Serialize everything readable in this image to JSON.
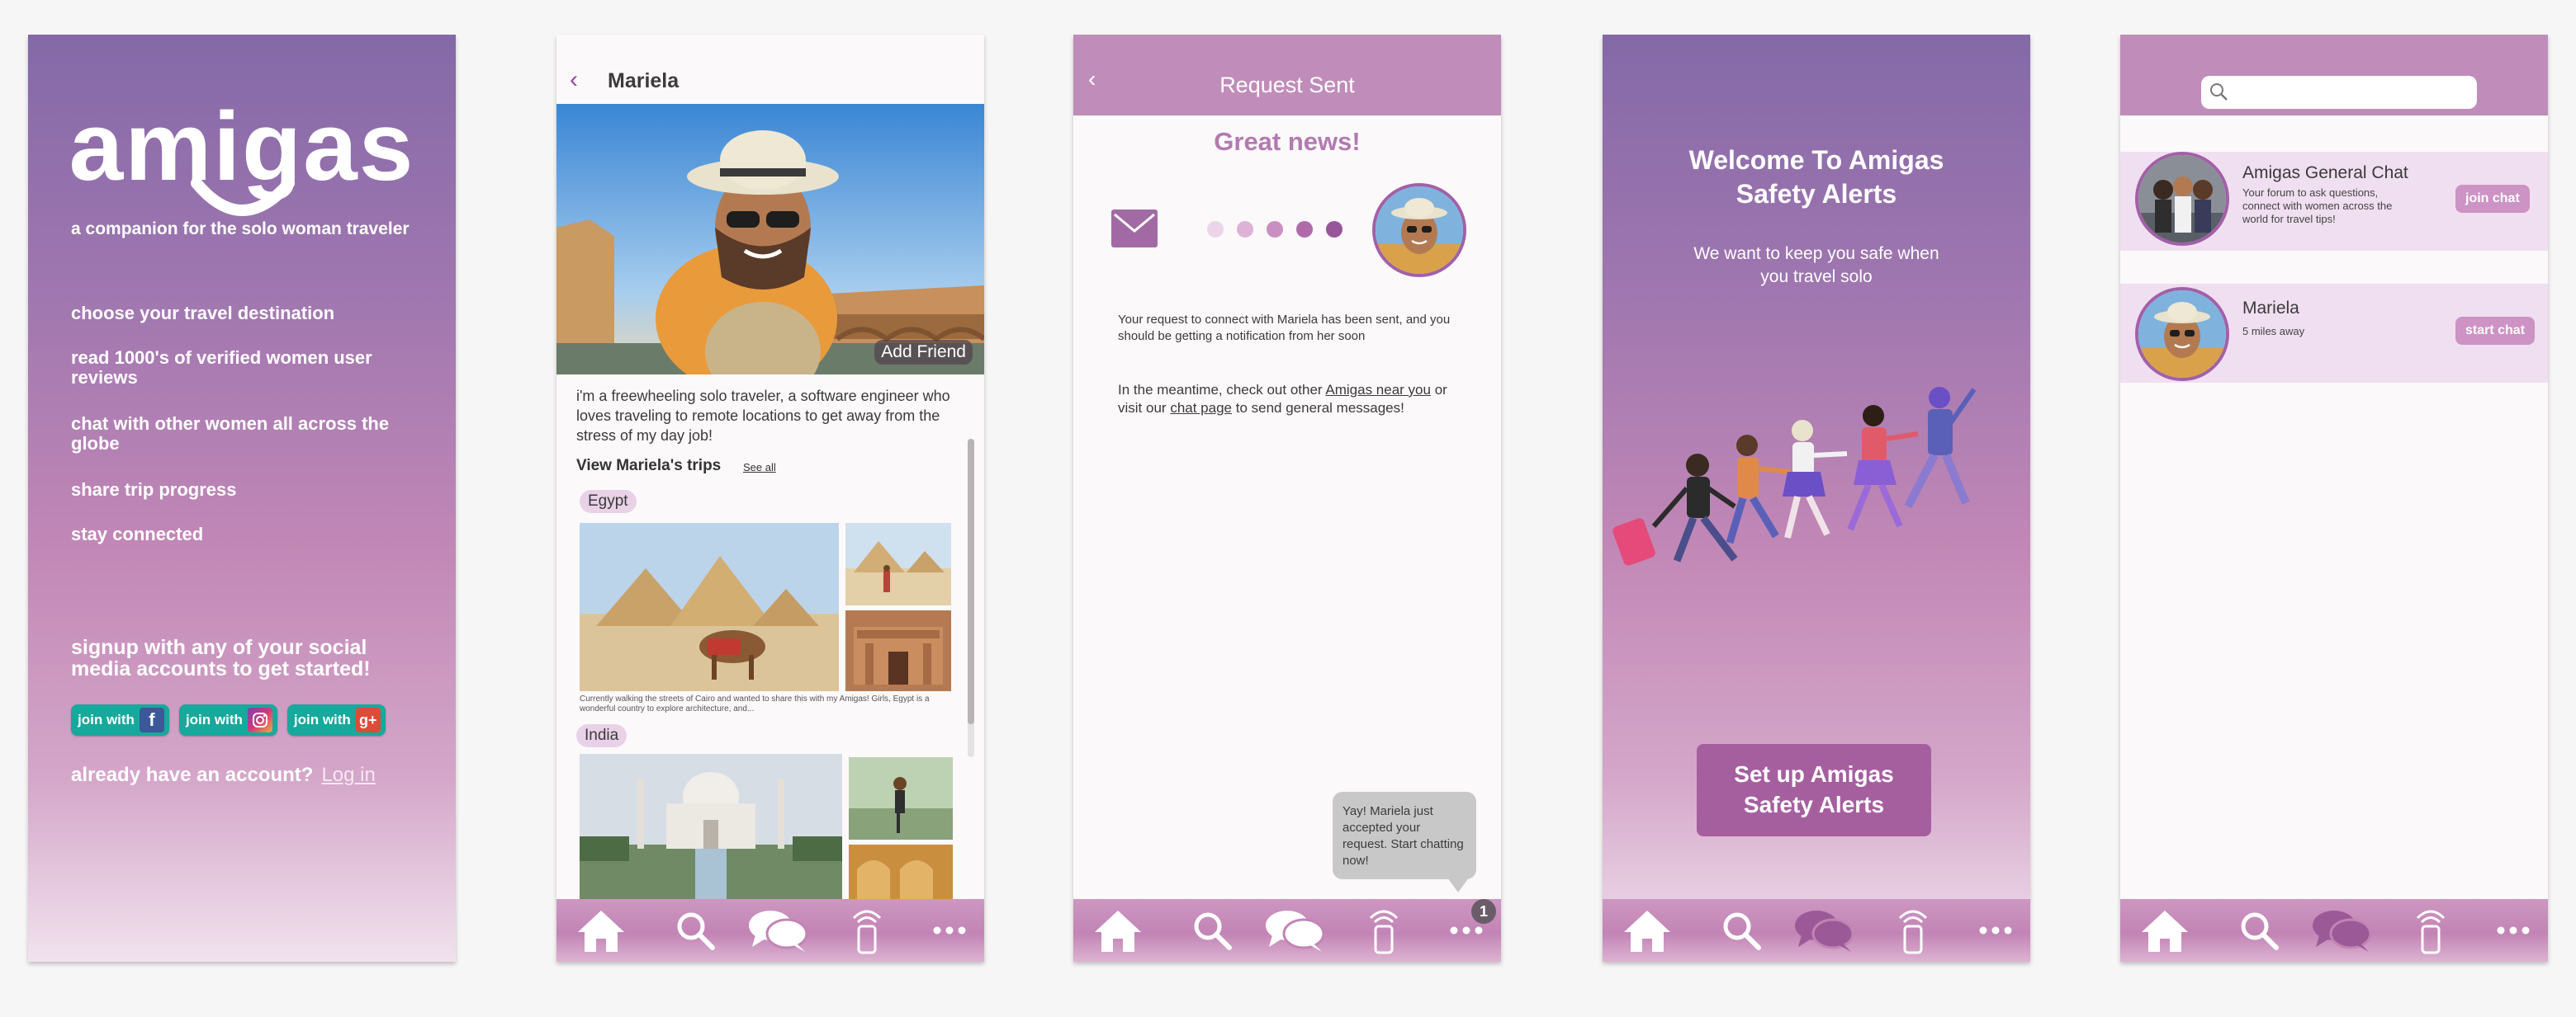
{
  "colors": {
    "accent": "#a55f9f",
    "teal": "#17a99b",
    "tab_bar": "#c284b5",
    "header": "#c08cb9",
    "chip": "#e9d2e8"
  },
  "tabbar": {
    "items": [
      "home-icon",
      "search-icon",
      "chat-icon",
      "signal-icon",
      "more-icon"
    ]
  },
  "onboarding": {
    "logo": "amigas",
    "tagline": "a companion for the solo woman traveler",
    "features": [
      "choose your travel destination",
      "read 1000's of verified women user reviews",
      "chat with other women all across the globe",
      "share trip progress",
      "stay connected"
    ],
    "signup_prompt": "signup with any of your social media accounts to get started!",
    "join_label": "join with",
    "social": [
      "facebook-icon",
      "instagram-icon",
      "google-plus-icon"
    ],
    "login_prompt": "already have an account?",
    "login_link": "Log in"
  },
  "profile": {
    "name": "Mariela",
    "add_friend": "Add Friend",
    "bio": "i'm a freewheeling solo traveler, a software engineer who loves traveling to remote locations to get away from the stress of my day job!",
    "trips_title": "View Mariela's trips",
    "see_all": "See all",
    "trips": [
      {
        "place": "Egypt",
        "caption": "Currently walking the streets of Cairo and wanted to share this with my Amigas! Girls, Egypt is a wonderful country to explore architecture, and..."
      },
      {
        "place": "India"
      }
    ]
  },
  "request": {
    "title": "Request Sent",
    "headline": "Great news!",
    "message": "Your request to connect with Mariela has been sent, and you should be getting a notification from her soon",
    "meantime_pre": "In the meantime, check out other",
    "meantime_link1": "Amigas near you",
    "meantime_mid": "or visit our",
    "meantime_link2": "chat page",
    "meantime_post": "to send general messages!",
    "toast": "Yay! Mariela just accepted your request. Start chatting now!",
    "badge": "1"
  },
  "safety": {
    "title": "Welcome To Amigas Safety Alerts",
    "subtitle": "We want to keep you safe when you travel solo",
    "cta": "Set up Amigas Safety Alerts"
  },
  "chats": {
    "search_placeholder": "",
    "items": [
      {
        "name": "Amigas General Chat",
        "desc": "Your forum to ask questions, connect with women across the world for travel tips!",
        "button": "join chat"
      },
      {
        "name": "Mariela",
        "desc": "5 miles away",
        "button": "start chat"
      }
    ]
  }
}
